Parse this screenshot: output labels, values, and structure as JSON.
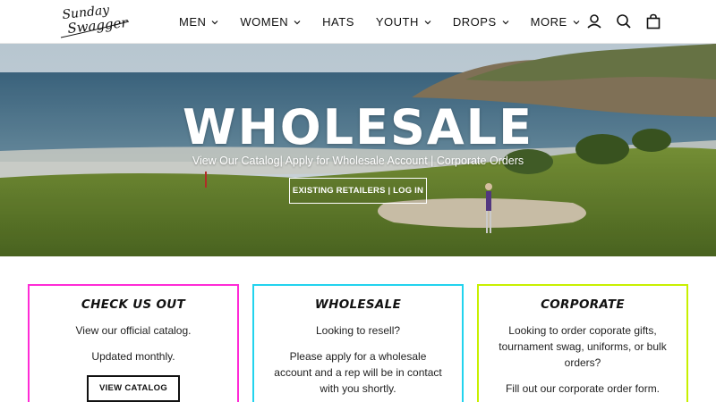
{
  "brand": {
    "logo_text_1": "Sunday",
    "logo_text_2": "Swagger"
  },
  "nav": [
    {
      "label": "MEN",
      "has_dropdown": true
    },
    {
      "label": "WOMEN",
      "has_dropdown": true
    },
    {
      "label": "HATS",
      "has_dropdown": false
    },
    {
      "label": "YOUTH",
      "has_dropdown": true
    },
    {
      "label": "DROPS",
      "has_dropdown": true
    },
    {
      "label": "MORE",
      "has_dropdown": true
    }
  ],
  "header_icons": [
    "account-icon",
    "search-icon",
    "cart-icon"
  ],
  "hero": {
    "title": "WHOLESALE",
    "subtitle": "View Our Catalog| Apply for Wholesale Account | Corporate Orders",
    "button": "EXISTING RETAILERS | LOG IN"
  },
  "cards": [
    {
      "title": "CHECK US OUT",
      "border_color": "#ff2bd6",
      "lines": [
        "View our official catalog.",
        "Updated monthly."
      ],
      "button": "VIEW CATALOG"
    },
    {
      "title": "WHOLESALE",
      "border_color": "#22d3ee",
      "lines": [
        "Looking to resell?",
        "Please apply for a wholesale account and a rep will be in contact with you shortly."
      ]
    },
    {
      "title": "CORPORATE",
      "border_color": "#c8f000",
      "lines": [
        "Looking to order coporate gifts, tournament swag, uniforms, or bulk orders?",
        "Fill out our corporate order form."
      ]
    }
  ]
}
